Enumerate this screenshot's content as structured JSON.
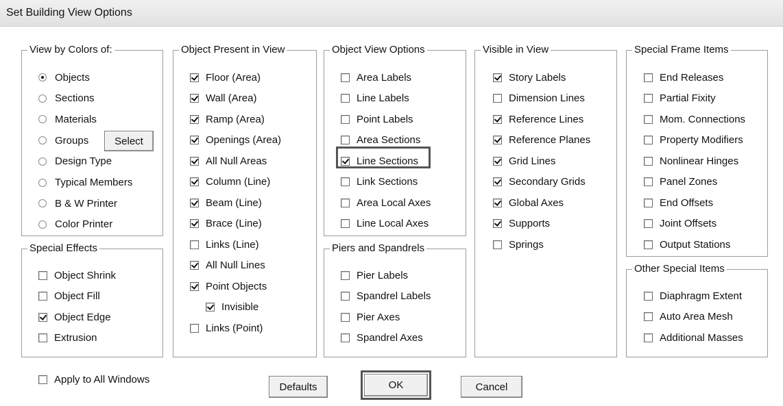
{
  "window": {
    "title": "Set Building View Options"
  },
  "view_by_colors": {
    "legend": "View by Colors of:",
    "options": [
      {
        "label": "Objects",
        "selected": true
      },
      {
        "label": "Sections",
        "selected": false
      },
      {
        "label": "Materials",
        "selected": false
      },
      {
        "label": "Groups",
        "selected": false
      },
      {
        "label": "Design Type",
        "selected": false
      },
      {
        "label": "Typical Members",
        "selected": false
      },
      {
        "label": "B & W Printer",
        "selected": false
      },
      {
        "label": "Color Printer",
        "selected": false
      }
    ],
    "select_button": "Select"
  },
  "special_effects": {
    "legend": "Special Effects",
    "items": [
      {
        "label": "Object Shrink",
        "checked": false
      },
      {
        "label": "Object Fill",
        "checked": false
      },
      {
        "label": "Object Edge",
        "checked": true
      },
      {
        "label": "Extrusion",
        "checked": false
      }
    ]
  },
  "object_present": {
    "legend": "Object Present in View",
    "items": [
      {
        "label": "Floor (Area)",
        "checked": true
      },
      {
        "label": "Wall (Area)",
        "checked": true
      },
      {
        "label": "Ramp (Area)",
        "checked": true
      },
      {
        "label": "Openings (Area)",
        "checked": true
      },
      {
        "label": "All Null Areas",
        "checked": true
      },
      {
        "label": "Column (Line)",
        "checked": true
      },
      {
        "label": "Beam (Line)",
        "checked": true
      },
      {
        "label": "Brace (Line)",
        "checked": true
      },
      {
        "label": "Links (Line)",
        "checked": false
      },
      {
        "label": "All Null Lines",
        "checked": true
      },
      {
        "label": "Point Objects",
        "checked": true
      },
      {
        "label": "Invisible",
        "checked": true
      },
      {
        "label": "Links (Point)",
        "checked": false
      }
    ]
  },
  "object_view_options": {
    "legend": "Object View Options",
    "items": [
      {
        "label": "Area Labels",
        "checked": false
      },
      {
        "label": "Line Labels",
        "checked": false
      },
      {
        "label": "Point Labels",
        "checked": false
      },
      {
        "label": "Area Sections",
        "checked": false
      },
      {
        "label": "Line Sections",
        "checked": true
      },
      {
        "label": "Link Sections",
        "checked": false
      },
      {
        "label": "Area Local Axes",
        "checked": false
      },
      {
        "label": "Line Local Axes",
        "checked": false
      }
    ]
  },
  "piers_spandrels": {
    "legend": "Piers and Spandrels",
    "items": [
      {
        "label": "Pier Labels",
        "checked": false
      },
      {
        "label": "Spandrel Labels",
        "checked": false
      },
      {
        "label": "Pier Axes",
        "checked": false
      },
      {
        "label": "Spandrel Axes",
        "checked": false
      }
    ]
  },
  "visible_in_view": {
    "legend": "Visible in View",
    "items": [
      {
        "label": "Story Labels",
        "checked": true
      },
      {
        "label": "Dimension Lines",
        "checked": false
      },
      {
        "label": "Reference Lines",
        "checked": true
      },
      {
        "label": "Reference Planes",
        "checked": true
      },
      {
        "label": "Grid Lines",
        "checked": true
      },
      {
        "label": "Secondary Grids",
        "checked": true
      },
      {
        "label": "Global Axes",
        "checked": true
      },
      {
        "label": "Supports",
        "checked": true
      },
      {
        "label": "Springs",
        "checked": false
      }
    ]
  },
  "special_frame": {
    "legend": "Special Frame Items",
    "items": [
      {
        "label": "End Releases",
        "checked": false
      },
      {
        "label": "Partial Fixity",
        "checked": false
      },
      {
        "label": "Mom. Connections",
        "checked": false
      },
      {
        "label": "Property Modifiers",
        "checked": false
      },
      {
        "label": "Nonlinear Hinges",
        "checked": false
      },
      {
        "label": "Panel Zones",
        "checked": false
      },
      {
        "label": "End Offsets",
        "checked": false
      },
      {
        "label": "Joint Offsets",
        "checked": false
      },
      {
        "label": "Output Stations",
        "checked": false
      }
    ]
  },
  "other_special": {
    "legend": "Other Special Items",
    "items": [
      {
        "label": "Diaphragm Extent",
        "checked": false
      },
      {
        "label": "Auto Area Mesh",
        "checked": false
      },
      {
        "label": "Additional Masses",
        "checked": false
      }
    ]
  },
  "apply_all": {
    "label": "Apply to All Windows",
    "checked": false
  },
  "buttons": {
    "defaults": "Defaults",
    "ok": "OK",
    "cancel": "Cancel"
  }
}
